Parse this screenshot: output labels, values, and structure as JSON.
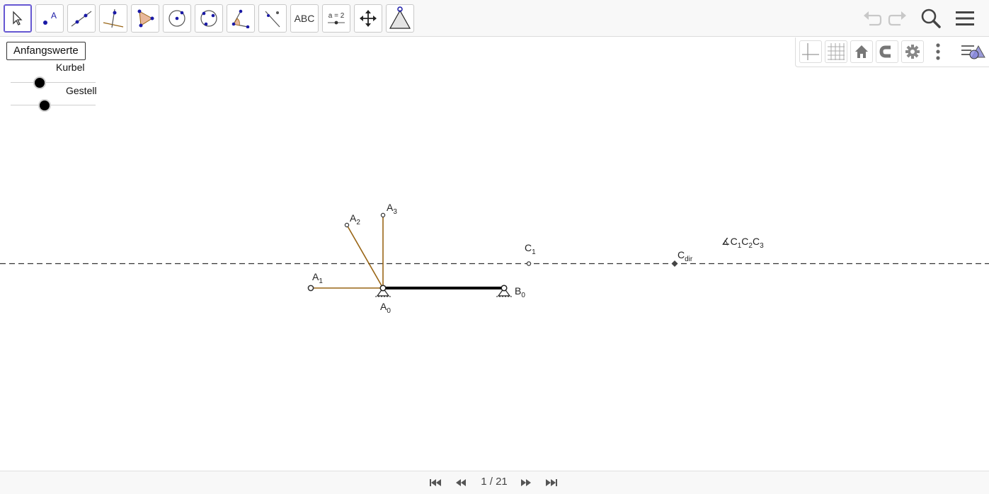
{
  "toolbar": {
    "tools": [
      {
        "name": "move-tool"
      },
      {
        "name": "point-tool",
        "glyph": "A"
      },
      {
        "name": "line-tool"
      },
      {
        "name": "perpendicular-line-tool"
      },
      {
        "name": "polygon-tool"
      },
      {
        "name": "circle-center-point-tool"
      },
      {
        "name": "conic-tool"
      },
      {
        "name": "angle-tool"
      },
      {
        "name": "reflect-tool"
      },
      {
        "name": "text-tool",
        "label": "ABC"
      },
      {
        "name": "slider-tool",
        "label": "a = 2"
      },
      {
        "name": "move-graphics-view-tool"
      },
      {
        "name": "custom-tool"
      }
    ],
    "right_icons": [
      "undo-icon",
      "redo-icon",
      "search-icon",
      "menu-icon"
    ]
  },
  "stylebar": {
    "icons": [
      "axes-icon",
      "grid-icon",
      "home-icon",
      "point-capturing-icon",
      "settings-icon",
      "more-icon",
      "toggle-stylebar-icon"
    ]
  },
  "controls": {
    "reset_label": "Anfangswerte",
    "sliders": [
      {
        "label": "Kurbel",
        "value_fraction": 0.33
      },
      {
        "label": "Gestell",
        "value_fraction": 0.4
      }
    ]
  },
  "construction": {
    "labels": {
      "A1": {
        "base": "A",
        "sub": "1"
      },
      "A2": {
        "base": "A",
        "sub": "2"
      },
      "A3": {
        "base": "A",
        "sub": "3"
      },
      "A0": {
        "base": "A",
        "sub": "0"
      },
      "B0": {
        "base": "B",
        "sub": "0"
      },
      "C1": {
        "base": "C",
        "sub": "1"
      },
      "Cdir": {
        "base": "C",
        "sub": "dir"
      },
      "angle": {
        "symbol": "∡",
        "parts": [
          [
            "C",
            "1"
          ],
          [
            "C",
            "2"
          ],
          [
            "C",
            "3"
          ]
        ]
      }
    },
    "colors": {
      "crank": "#996515",
      "frame": "#000000",
      "line": "#000000"
    }
  },
  "navigation": {
    "page_text": "1 / 21",
    "buttons": [
      "first-page-button",
      "previous-page-button",
      "next-page-button",
      "last-page-button"
    ]
  }
}
